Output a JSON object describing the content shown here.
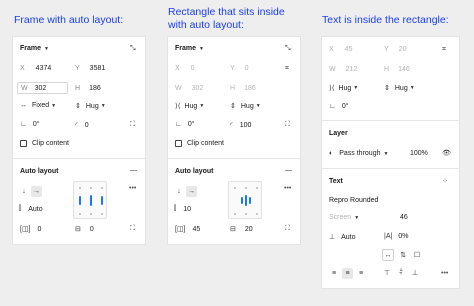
{
  "captions": {
    "c1": "Frame with auto layout:",
    "c2_line1": "Rectangle that sits inside",
    "c2_line2": "with auto layout:",
    "c3": "Text is inside the rectangle:"
  },
  "panel1": {
    "frame_title": "Frame",
    "x_label": "X",
    "x_value": "4374",
    "y_label": "Y",
    "y_value": "3581",
    "w_label": "W",
    "w_value": "302",
    "h_label": "H",
    "h_value": "186",
    "width_mode": "Fixed",
    "height_mode": "Hug",
    "rotation": "0°",
    "radius": "0",
    "clip_content": "Clip content",
    "auto_layout_title": "Auto layout",
    "spacing_value": "Auto",
    "padding_h": "0",
    "padding_v": "0"
  },
  "panel2": {
    "frame_title": "Frame",
    "x_label": "X",
    "x_value": "0",
    "y_label": "Y",
    "y_value": "0",
    "w_label": "W",
    "w_value": "302",
    "h_label": "H",
    "h_value": "186",
    "width_mode": "Hug",
    "height_mode": "Hug",
    "rotation": "0°",
    "radius": "100",
    "clip_content": "Clip content",
    "auto_layout_title": "Auto layout",
    "spacing_value": "10",
    "padding_h": "45",
    "padding_v": "20"
  },
  "panel3": {
    "x_label": "X",
    "x_value": "45",
    "y_label": "Y",
    "y_value": "20",
    "w_label": "W",
    "w_value": "212",
    "h_label": "H",
    "h_value": "146",
    "width_mode": "Hug",
    "height_mode": "Hug",
    "rotation": "0°",
    "layer_title": "Layer",
    "blend_mode": "Pass through",
    "opacity": "100%",
    "text_title": "Text",
    "font_name": "Repro Rounded",
    "font_style": "Screen",
    "font_size": "46",
    "line_height": "Auto",
    "letter_spacing": "0%"
  }
}
